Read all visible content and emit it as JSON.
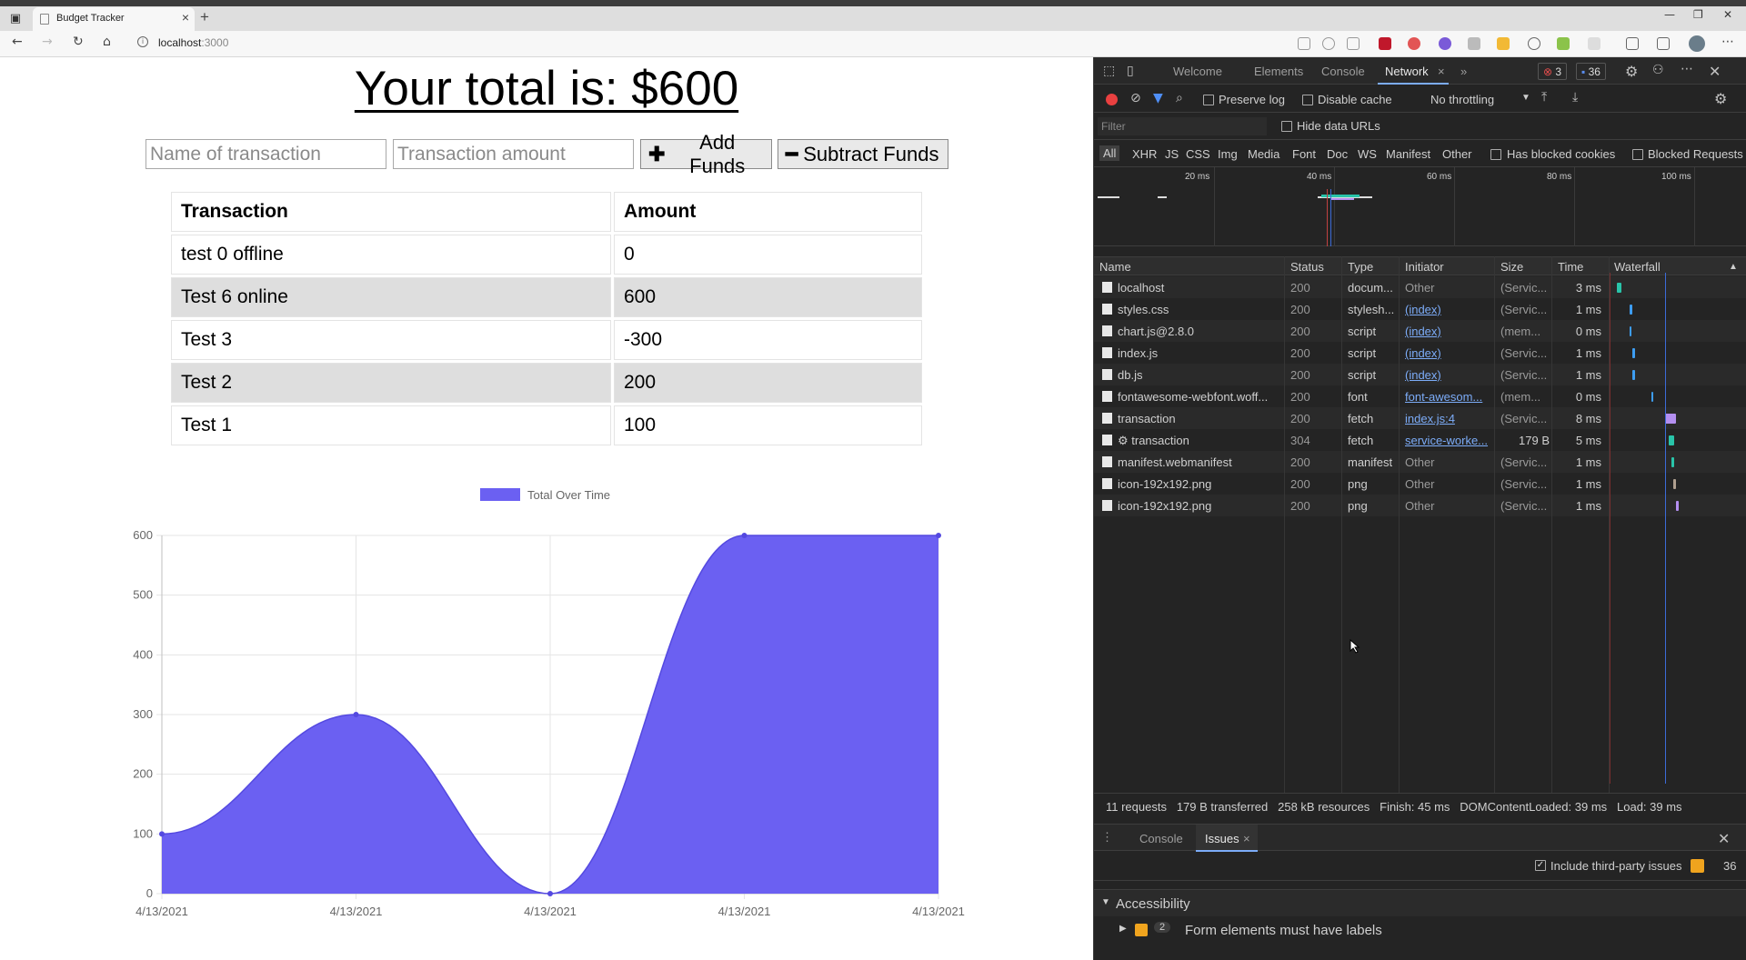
{
  "browser": {
    "tab_title": "Budget Tracker",
    "address_host": "localhost",
    "address_port": ":3000"
  },
  "page": {
    "total_heading": "Your total is: $600",
    "name_placeholder": "Name of transaction",
    "amount_placeholder": "Transaction amount",
    "add_button": "Add Funds",
    "subtract_button": "Subtract Funds",
    "table_headers": [
      "Transaction",
      "Amount"
    ],
    "transactions": [
      {
        "name": "test 0 offline",
        "amount": "0"
      },
      {
        "name": "Test 6 online",
        "amount": "600"
      },
      {
        "name": "Test 3",
        "amount": "-300"
      },
      {
        "name": "Test 2",
        "amount": "200"
      },
      {
        "name": "Test 1",
        "amount": "100"
      }
    ]
  },
  "chart_data": {
    "type": "area",
    "categories": [
      "4/13/2021",
      "4/13/2021",
      "4/13/2021",
      "4/13/2021",
      "4/13/2021"
    ],
    "series": [
      {
        "name": "Total Over Time",
        "values": [
          100,
          300,
          0,
          600,
          600
        ],
        "color": "#6b60f2"
      }
    ],
    "ylim": [
      0,
      600
    ],
    "yticks": [
      0,
      100,
      200,
      300,
      400,
      500,
      600
    ],
    "grid": true,
    "legend": "top"
  },
  "devtools": {
    "tabs": [
      "Welcome",
      "Elements",
      "Console",
      "Network"
    ],
    "active_tab": "Network",
    "error_count": "3",
    "warning_count": "36",
    "preserve_log": "Preserve log",
    "disable_cache": "Disable cache",
    "throttling": "No throttling",
    "filter_placeholder": "Filter",
    "hide_data_urls": "Hide data URLs",
    "filter_types": [
      "All",
      "XHR",
      "JS",
      "CSS",
      "Img",
      "Media",
      "Font",
      "Doc",
      "WS",
      "Manifest",
      "Other"
    ],
    "has_blocked_cookies": "Has blocked cookies",
    "blocked_requests": "Blocked Requests",
    "overview_ticks": [
      "20 ms",
      "40 ms",
      "60 ms",
      "80 ms",
      "100 ms"
    ],
    "columns": [
      "Name",
      "Status",
      "Type",
      "Initiator",
      "Size",
      "Time",
      "Waterfall"
    ],
    "requests": [
      {
        "name": "localhost",
        "status": "200",
        "type": "docum...",
        "initiator": "Other",
        "initiator_link": false,
        "size": "(Servic...",
        "time": "3 ms",
        "wf_color": "#29c4a9"
      },
      {
        "name": "styles.css",
        "status": "200",
        "type": "stylesh...",
        "initiator": "(index)",
        "initiator_link": true,
        "size": "(Servic...",
        "time": "1 ms",
        "wf_color": "#3d9df2"
      },
      {
        "name": "chart.js@2.8.0",
        "status": "200",
        "type": "script",
        "initiator": "(index)",
        "initiator_link": true,
        "size": "(mem...",
        "time": "0 ms",
        "wf_color": "#3d9df2"
      },
      {
        "name": "index.js",
        "status": "200",
        "type": "script",
        "initiator": "(index)",
        "initiator_link": true,
        "size": "(Servic...",
        "time": "1 ms",
        "wf_color": "#3d9df2"
      },
      {
        "name": "db.js",
        "status": "200",
        "type": "script",
        "initiator": "(index)",
        "initiator_link": true,
        "size": "(Servic...",
        "time": "1 ms",
        "wf_color": "#3d9df2"
      },
      {
        "name": "fontawesome-webfont.woff...",
        "status": "200",
        "type": "font",
        "initiator": "font-awesom...",
        "initiator_link": true,
        "size": "(mem...",
        "time": "0 ms",
        "wf_color": "#3d9df2"
      },
      {
        "name": "transaction",
        "status": "200",
        "type": "fetch",
        "initiator": "index.js:4",
        "initiator_link": true,
        "size": "(Servic...",
        "time": "8 ms",
        "wf_color": "#b48ff0"
      },
      {
        "name": "⚙ transaction",
        "status": "304",
        "type": "fetch",
        "initiator": "service-worke...",
        "initiator_link": true,
        "size": "179 B",
        "time": "5 ms",
        "wf_color": "#29c4a9"
      },
      {
        "name": "manifest.webmanifest",
        "status": "200",
        "type": "manifest",
        "initiator": "Other",
        "initiator_link": false,
        "size": "(Servic...",
        "time": "1 ms",
        "wf_color": "#29c4a9"
      },
      {
        "name": "icon-192x192.png",
        "status": "200",
        "type": "png",
        "initiator": "Other",
        "initiator_link": false,
        "size": "(Servic...",
        "time": "1 ms",
        "wf_color": "#b0a090"
      },
      {
        "name": "icon-192x192.png",
        "status": "200",
        "type": "png",
        "initiator": "Other",
        "initiator_link": false,
        "size": "(Servic...",
        "time": "1 ms",
        "wf_color": "#b48ff0"
      }
    ],
    "summary": {
      "requests": "11 requests",
      "transferred": "179 B transferred",
      "resources": "258 kB resources",
      "finish": "Finish: 45 ms",
      "dcl": "DOMContentLoaded: 39 ms",
      "load": "Load: 39 ms"
    },
    "drawer_tabs": [
      "Console",
      "Issues"
    ],
    "include_third_party": "Include third-party issues",
    "issues_count": "36",
    "accessibility": "Accessibility",
    "issue_count_small": "2",
    "issue_title": "Form elements must have labels"
  }
}
